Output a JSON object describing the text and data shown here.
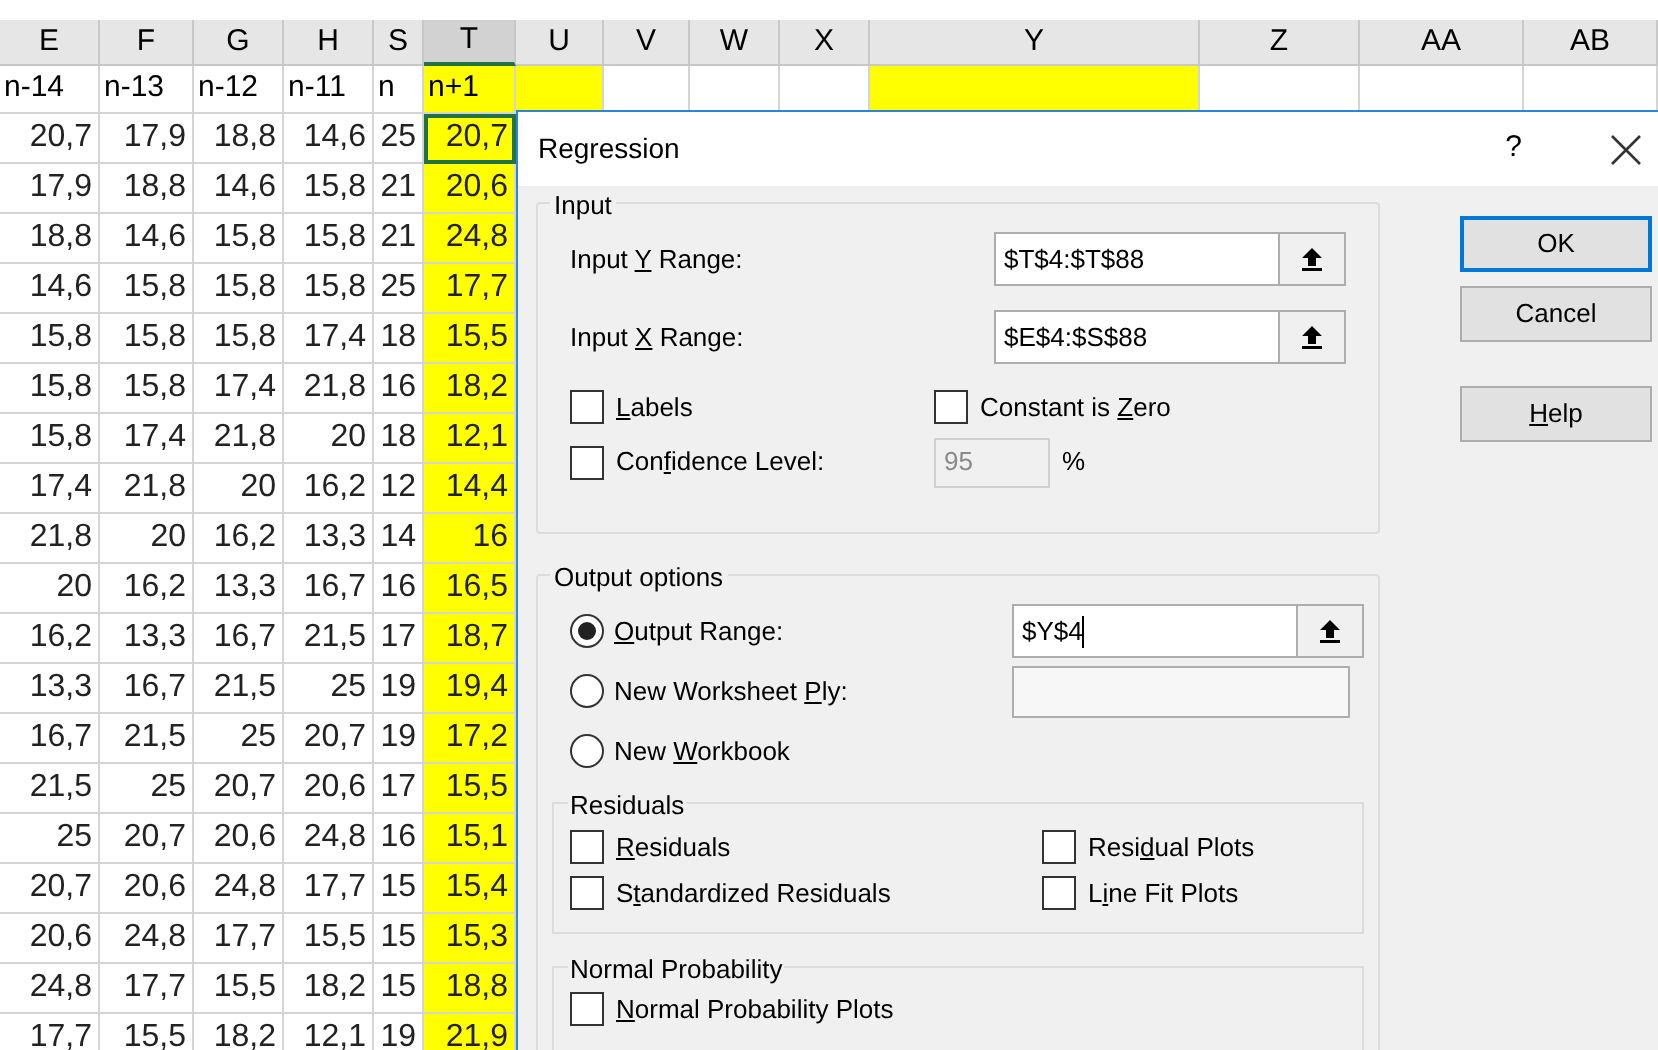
{
  "sheet": {
    "columns": [
      {
        "letter": "E",
        "label": "n-14",
        "highlighted": false,
        "selected": false
      },
      {
        "letter": "F",
        "label": "n-13",
        "highlighted": false,
        "selected": false
      },
      {
        "letter": "G",
        "label": "n-12",
        "highlighted": false,
        "selected": false
      },
      {
        "letter": "H",
        "label": "n-11",
        "highlighted": false,
        "selected": false
      },
      {
        "letter": "S",
        "label": "n",
        "highlighted": false,
        "selected": false
      },
      {
        "letter": "T",
        "label": "n+1",
        "highlighted": true,
        "selected": true
      },
      {
        "letter": "U",
        "highlighted": true,
        "selected": false
      },
      {
        "letter": "V",
        "highlighted": false,
        "selected": false
      },
      {
        "letter": "W",
        "highlighted": false,
        "selected": false
      },
      {
        "letter": "X",
        "highlighted": false,
        "selected": false
      },
      {
        "letter": "Y",
        "highlighted": true,
        "selected": false
      },
      {
        "letter": "Z",
        "highlighted": false,
        "selected": false
      },
      {
        "letter": "AA",
        "highlighted": false,
        "selected": false
      },
      {
        "letter": "AB",
        "highlighted": false,
        "selected": false
      }
    ],
    "rows": [
      {
        "cells": [
          "20,7",
          "17,9",
          "18,8",
          "14,6",
          "25",
          "20,7"
        ],
        "selected": true
      },
      {
        "cells": [
          "17,9",
          "18,8",
          "14,6",
          "15,8",
          "21",
          "20,6"
        ],
        "selected": false
      },
      {
        "cells": [
          "18,8",
          "14,6",
          "15,8",
          "15,8",
          "21",
          "24,8"
        ],
        "selected": false
      },
      {
        "cells": [
          "14,6",
          "15,8",
          "15,8",
          "15,8",
          "25",
          "17,7"
        ],
        "selected": false
      },
      {
        "cells": [
          "15,8",
          "15,8",
          "15,8",
          "17,4",
          "18",
          "15,5"
        ],
        "selected": false
      },
      {
        "cells": [
          "15,8",
          "15,8",
          "17,4",
          "21,8",
          "16",
          "18,2"
        ],
        "selected": false
      },
      {
        "cells": [
          "15,8",
          "17,4",
          "21,8",
          "20",
          "18",
          "12,1"
        ],
        "selected": false
      },
      {
        "cells": [
          "17,4",
          "21,8",
          "20",
          "16,2",
          "12",
          "14,4"
        ],
        "selected": false
      },
      {
        "cells": [
          "21,8",
          "20",
          "16,2",
          "13,3",
          "14",
          "16"
        ],
        "selected": false
      },
      {
        "cells": [
          "20",
          "16,2",
          "13,3",
          "16,7",
          "16",
          "16,5"
        ],
        "selected": false
      },
      {
        "cells": [
          "16,2",
          "13,3",
          "16,7",
          "21,5",
          "17",
          "18,7"
        ],
        "selected": false
      },
      {
        "cells": [
          "13,3",
          "16,7",
          "21,5",
          "25",
          "19",
          "19,4"
        ],
        "selected": false
      },
      {
        "cells": [
          "16,7",
          "21,5",
          "25",
          "20,7",
          "19",
          "17,2"
        ],
        "selected": false
      },
      {
        "cells": [
          "21,5",
          "25",
          "20,7",
          "20,6",
          "17",
          "15,5"
        ],
        "selected": false
      },
      {
        "cells": [
          "25",
          "20,7",
          "20,6",
          "24,8",
          "16",
          "15,1"
        ],
        "selected": false
      },
      {
        "cells": [
          "20,7",
          "20,6",
          "24,8",
          "17,7",
          "15",
          "15,4"
        ],
        "selected": false
      },
      {
        "cells": [
          "20,6",
          "24,8",
          "17,7",
          "15,5",
          "15",
          "15,3"
        ],
        "selected": false
      },
      {
        "cells": [
          "24,8",
          "17,7",
          "15,5",
          "18,2",
          "15",
          "18,8"
        ],
        "selected": false
      },
      {
        "cells": [
          "17,7",
          "15,5",
          "18,2",
          "12,1",
          "19",
          "21,9"
        ],
        "selected": false
      }
    ]
  },
  "dialog": {
    "title": "Regression",
    "help": "?",
    "input": {
      "title": "Input",
      "ranges": [
        {
          "label": [
            {
              "t": "Input ",
              "u": false
            },
            {
              "t": "Y",
              "u": true
            },
            {
              "t": " Range:",
              "u": false
            }
          ],
          "value": "$T$4:$T$88"
        },
        {
          "label": [
            {
              "t": "Input ",
              "u": false
            },
            {
              "t": "X",
              "u": true
            },
            {
              "t": " Range:",
              "u": false
            }
          ],
          "value": "$E$4:$S$88"
        }
      ],
      "labels": {
        "label": [
          {
            "t": "L",
            "u": true
          },
          {
            "t": "abels",
            "u": false
          }
        ],
        "checked": false
      },
      "constant": {
        "label": [
          {
            "t": "Constant is ",
            "u": false
          },
          {
            "t": "Z",
            "u": true
          },
          {
            "t": "ero",
            "u": false
          }
        ],
        "checked": false
      },
      "confidence": {
        "label": [
          {
            "t": "Con",
            "u": false
          },
          {
            "t": "f",
            "u": true
          },
          {
            "t": "idence Level:",
            "u": false
          }
        ],
        "checked": false,
        "value": "95",
        "unit": "%",
        "disabled": true
      }
    },
    "buttons": [
      {
        "label": [
          {
            "t": "OK",
            "u": false
          }
        ],
        "default": true
      },
      {
        "label": [
          {
            "t": "Cancel",
            "u": false
          }
        ],
        "default": false
      },
      {
        "label": [
          {
            "t": "H",
            "u": true
          },
          {
            "t": "elp",
            "u": false
          }
        ],
        "default": false
      }
    ],
    "output": {
      "title": "Output options",
      "choices": [
        {
          "label": [
            {
              "t": "O",
              "u": true
            },
            {
              "t": "utput Range:",
              "u": false
            }
          ],
          "selected": true,
          "kind": "range",
          "value": "$Y$4",
          "focused": true
        },
        {
          "label": [
            {
              "t": "New Worksheet ",
              "u": false
            },
            {
              "t": "P",
              "u": true
            },
            {
              "t": "ly:",
              "u": false
            }
          ],
          "selected": false,
          "kind": "range",
          "focused": false
        },
        {
          "label": [
            {
              "t": "New ",
              "u": false
            },
            {
              "t": "W",
              "u": true
            },
            {
              "t": "orkbook",
              "u": false
            }
          ],
          "selected": false,
          "kind": "plain"
        }
      ],
      "residuals": {
        "title": "Residuals",
        "options": [
          {
            "label": [
              {
                "t": "R",
                "u": true
              },
              {
                "t": "esiduals",
                "u": false
              }
            ],
            "checked": false
          },
          {
            "label": [
              {
                "t": "Resi",
                "u": false
              },
              {
                "t": "d",
                "u": true
              },
              {
                "t": "ual Plots",
                "u": false
              }
            ],
            "checked": false
          },
          {
            "label": [
              {
                "t": "S",
                "u": false
              },
              {
                "t": "t",
                "u": true
              },
              {
                "t": "andardized Residuals",
                "u": false
              }
            ],
            "checked": false
          },
          {
            "label": [
              {
                "t": "L",
                "u": false
              },
              {
                "t": "i",
                "u": true
              },
              {
                "t": "ne Fit Plots",
                "u": false
              }
            ],
            "checked": false
          }
        ]
      },
      "normal": {
        "title": "Normal Probability",
        "options": [
          {
            "label": [
              {
                "t": "N",
                "u": true
              },
              {
                "t": "ormal Probability Plots",
                "u": false
              }
            ],
            "checked": false
          }
        ]
      }
    }
  }
}
